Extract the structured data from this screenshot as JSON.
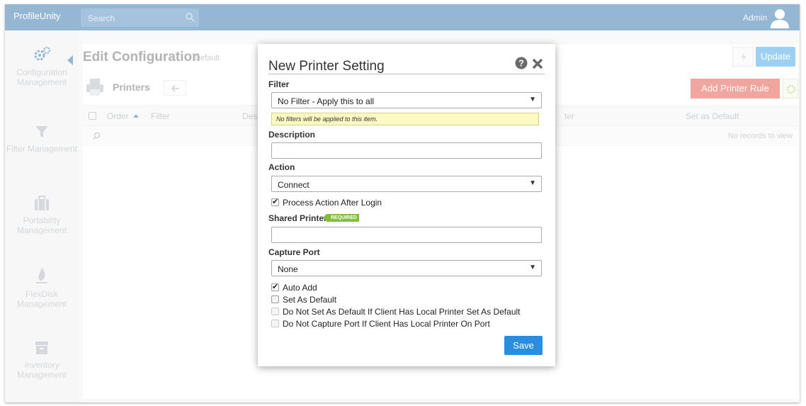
{
  "app": {
    "brand": "ProfileUnity",
    "search_placeholder": "Search",
    "user": "Admin"
  },
  "sidebar": {
    "items": [
      {
        "label": "Configuration Management",
        "icon": "gears-icon"
      },
      {
        "label": "Filter Management",
        "icon": "filter-icon"
      },
      {
        "label": "Portability Management",
        "icon": "briefcase-icon"
      },
      {
        "label": "FlexDisk Management",
        "icon": "flexdisk-icon"
      },
      {
        "label": "Inventory Management",
        "icon": "archive-icon"
      }
    ]
  },
  "main": {
    "title": "Edit Configuration",
    "subtitle": "Default",
    "update_label": "Update",
    "section_title": "Printers",
    "add_rule_label": "Add Printer Rule",
    "columns": [
      "Order",
      "Filter",
      "Desc",
      "ter",
      "Set as Default"
    ],
    "empty_text": "No records to view"
  },
  "modal": {
    "title": "New Printer Setting",
    "filter_label": "Filter",
    "filter_value": "No Filter - Apply this to all",
    "filter_hint": "No filters will be applied to this item.",
    "description_label": "Description",
    "description_value": "",
    "action_label": "Action",
    "action_value": "Connect",
    "process_after_login_label": "Process Action After Login",
    "process_after_login_checked": true,
    "shared_printer_label": "Shared Printer",
    "required_badge": "REQUIRED",
    "shared_printer_value": "",
    "capture_port_label": "Capture Port",
    "capture_port_value": "None",
    "checkboxes": [
      {
        "label": "Auto Add",
        "checked": true,
        "enabled": true
      },
      {
        "label": "Set As Default",
        "checked": false,
        "enabled": true
      },
      {
        "label": "Do Not Set As Default If Client Has Local Printer Set As Default",
        "checked": false,
        "enabled": false
      },
      {
        "label": "Do Not Capture Port If Client Has Local Printer On Port",
        "checked": false,
        "enabled": false
      }
    ],
    "save_label": "Save"
  },
  "colors": {
    "brand_blue": "#2d6ea6",
    "button_blue": "#2a8ee0",
    "danger_red": "#e04a3f",
    "required_green": "#7fbf3c",
    "hint_yellow": "#fcfac2"
  }
}
